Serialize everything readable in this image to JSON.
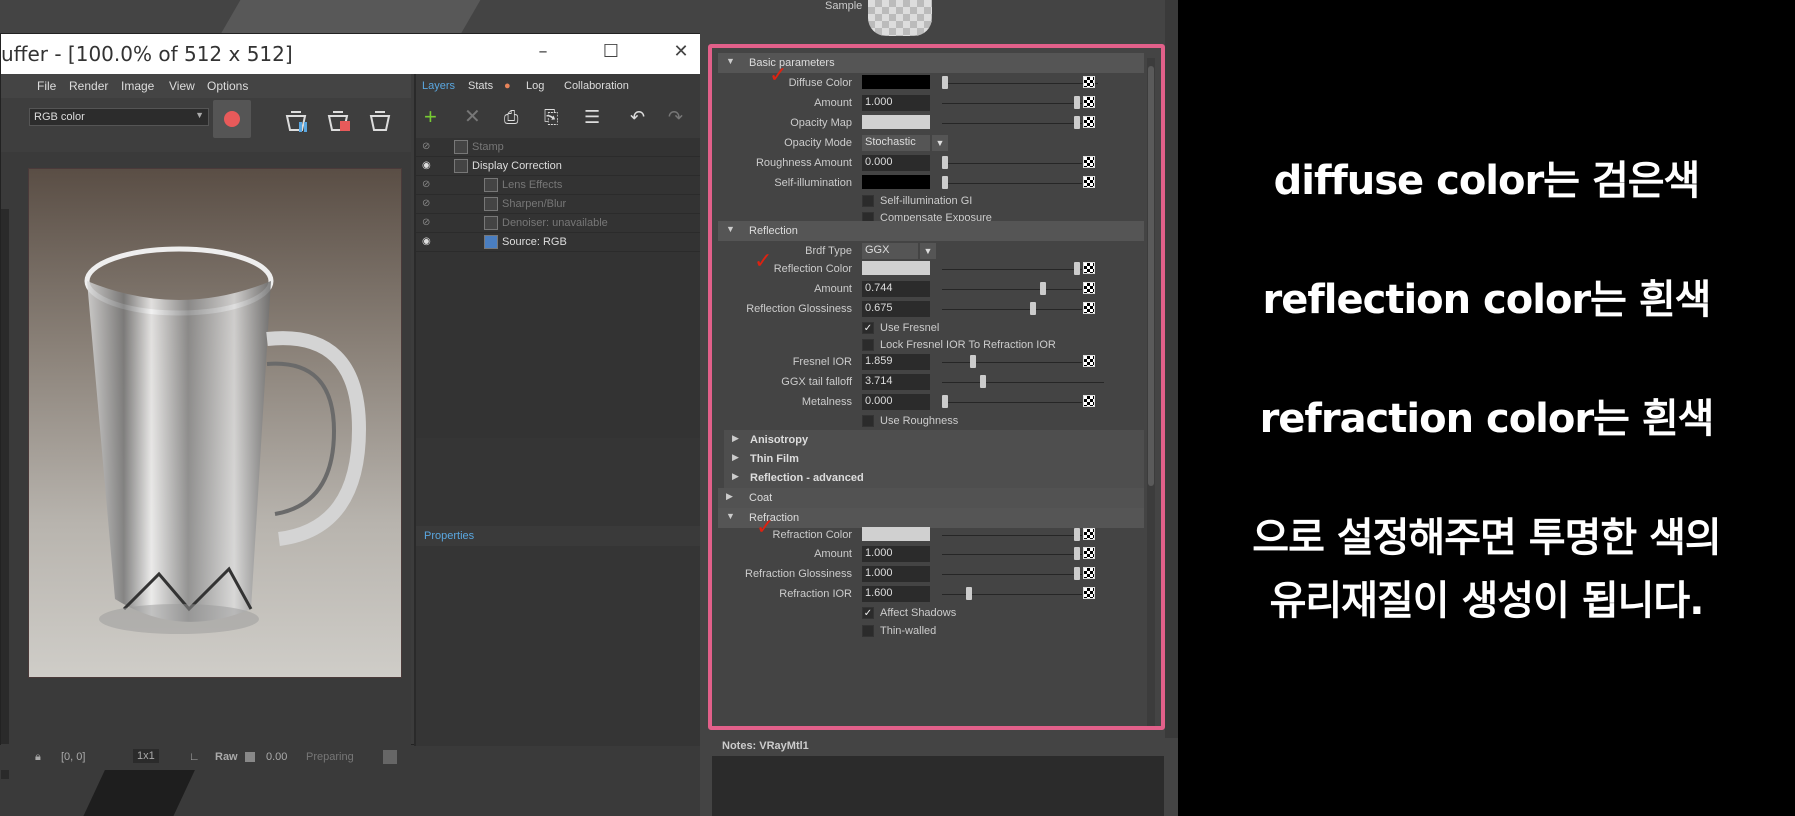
{
  "vfb": {
    "title": "uffer - [100.0% of 512 x 512]",
    "menu": [
      "File",
      "Render",
      "Image",
      "View",
      "Options"
    ],
    "channel_select": "RGB color",
    "tabs": [
      "Layers",
      "Stats",
      "Log",
      "Collaboration"
    ],
    "layers": [
      {
        "label": "Stamp",
        "dim": true
      },
      {
        "label": "Display Correction",
        "dim": false
      },
      {
        "label": "Lens Effects",
        "dim": true
      },
      {
        "label": "Sharpen/Blur",
        "dim": true
      },
      {
        "label": "Denoiser: unavailable",
        "dim": true
      },
      {
        "label": "Source: RGB",
        "dim": false
      }
    ],
    "properties_label": "Properties",
    "status": {
      "coords": "[0, 0]",
      "ratio": "1x1",
      "raw_label": "Raw",
      "raw_value": "0.00",
      "state": "Preparing"
    }
  },
  "attr": {
    "sample_label": "Sample",
    "basic": {
      "title": "Basic parameters",
      "diffuse_color": "Diffuse Color",
      "amount_label": "Amount",
      "amount": "1.000",
      "opacity_map": "Opacity Map",
      "opacity_mode_label": "Opacity Mode",
      "opacity_mode": "Stochastic",
      "roughness_label": "Roughness Amount",
      "roughness": "0.000",
      "self_illum": "Self-illumination",
      "self_illum_gi": "Self-illumination GI",
      "compensate": "Compensate Exposure"
    },
    "reflection": {
      "title": "Reflection",
      "brdf_label": "Brdf Type",
      "brdf": "GGX",
      "color_label": "Reflection Color",
      "amount_label": "Amount",
      "amount": "0.744",
      "gloss_label": "Reflection Glossiness",
      "gloss": "0.675",
      "use_fresnel": "Use Fresnel",
      "lock_fresnel": "Lock Fresnel IOR To Refraction IOR",
      "fresnel_ior_label": "Fresnel IOR",
      "fresnel_ior": "1.859",
      "ggx_label": "GGX tail falloff",
      "ggx": "3.714",
      "metal_label": "Metalness",
      "metal": "0.000",
      "use_roughness": "Use Roughness"
    },
    "subsections": [
      "Anisotropy",
      "Thin Film",
      "Reflection - advanced"
    ],
    "coat": "Coat",
    "refraction": {
      "title": "Refraction",
      "color_label": "Refraction Color",
      "amount_label": "Amount",
      "amount": "1.000",
      "gloss_label": "Refraction Glossiness",
      "gloss": "1.000",
      "ior_label": "Refraction IOR",
      "ior": "1.600",
      "affect_shadows": "Affect Shadows",
      "thin_walled": "Thin-walled"
    },
    "notes_label": "Notes:  VRayMtl1",
    "colors": {
      "diffuse": "#000000",
      "reflection": "#d0d0d0",
      "refraction": "#d0d0d0",
      "highlight": "#e2608a"
    }
  },
  "annotation": {
    "line1": "diffuse color는 검은색",
    "line2": "reflection color는 흰색",
    "line3": "refraction color는 흰색",
    "line4": "으로 설정해주면 투명한 색의",
    "line5": "유리재질이 생성이 됩니다."
  }
}
